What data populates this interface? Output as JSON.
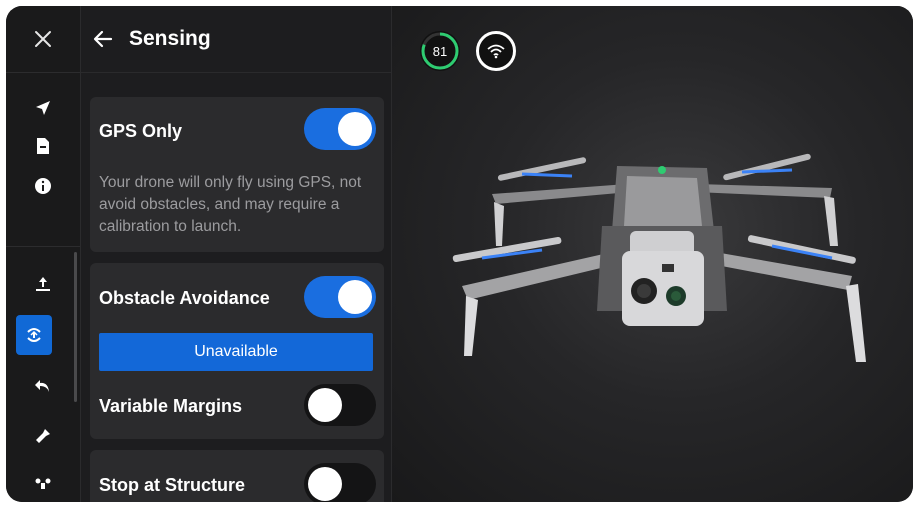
{
  "header": {
    "title": "Sensing"
  },
  "icons": {
    "close": "close-icon",
    "back": "back-arrow-icon",
    "rail": [
      "navigation-arrow-icon",
      "document-icon",
      "info-icon",
      "upload-icon",
      "sensing-icon",
      "return-icon",
      "flashlight-icon",
      "drone-icon"
    ]
  },
  "status": {
    "battery_percent": "81",
    "battery_ring_color": "#2ecc71",
    "connection": "wifi-icon"
  },
  "settings": {
    "gps_only": {
      "label": "GPS Only",
      "enabled": true,
      "description": "Your drone will only fly using GPS, not avoid obstacles, and may require a calibration to launch."
    },
    "obstacle_avoidance": {
      "label": "Obstacle Avoidance",
      "enabled": true,
      "status": "Unavailable"
    },
    "variable_margins": {
      "label": "Variable Margins",
      "enabled": false
    },
    "stop_at_structure": {
      "label": "Stop at Structure",
      "enabled": false
    }
  },
  "colors": {
    "accent": "#1a6ee0",
    "panel": "#1d1d1f",
    "card": "#2b2b2d"
  }
}
